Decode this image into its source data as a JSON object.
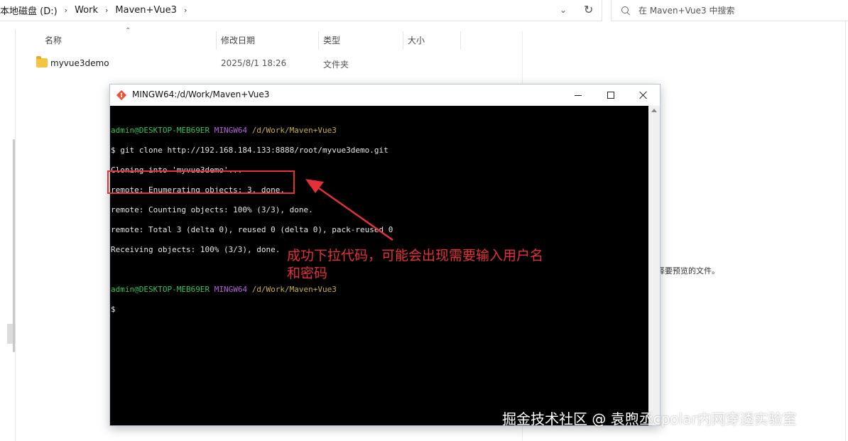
{
  "explorer": {
    "breadcrumb": [
      "本地磁盘 (D:)",
      "Work",
      "Maven+Vue3"
    ],
    "search_placeholder": "在 Maven+Vue3 中搜索",
    "columns": [
      "名称",
      "修改日期",
      "类型",
      "大小"
    ],
    "files": [
      {
        "name": "myvue3demo",
        "modified": "2025/8/1 18:26",
        "type": "文件夹",
        "size": ""
      }
    ],
    "preview_hint": "选择要预览的文件。"
  },
  "terminal": {
    "title": "MINGW64:/d/Work/Maven+Vue3",
    "prompt_user": "admin@DESKTOP-MEB69ER",
    "prompt_shell": "MINGW64",
    "prompt_path": "/d/Work/Maven+Vue3",
    "command": "$ git clone http://192.168.184.133:8888/root/myvue3demo.git",
    "output": [
      "Cloning into 'myvue3demo'...",
      "remote: Enumerating objects: 3, done.",
      "remote: Counting objects: 100% (3/3), done.",
      "remote: Total 3 (delta 0), reused 0 (delta 0), pack-reused 0",
      "Receiving objects: 100% (3/3), done."
    ],
    "cursor_prompt": "$"
  },
  "annotation": {
    "text_line1": "成功下拉代码，可能会出现需要输入用户名",
    "text_line2": "和密码",
    "color": "#e5303a"
  },
  "watermark": "掘金技术社区 @ 袁煦丞cpolar内网穿透实验室",
  "colors": {
    "terminal_bg": "#000000",
    "prompt_green": "#2ec45a",
    "prompt_purple": "#b463d8",
    "prompt_yellow": "#c7b13a",
    "folder": "#f5c542"
  }
}
